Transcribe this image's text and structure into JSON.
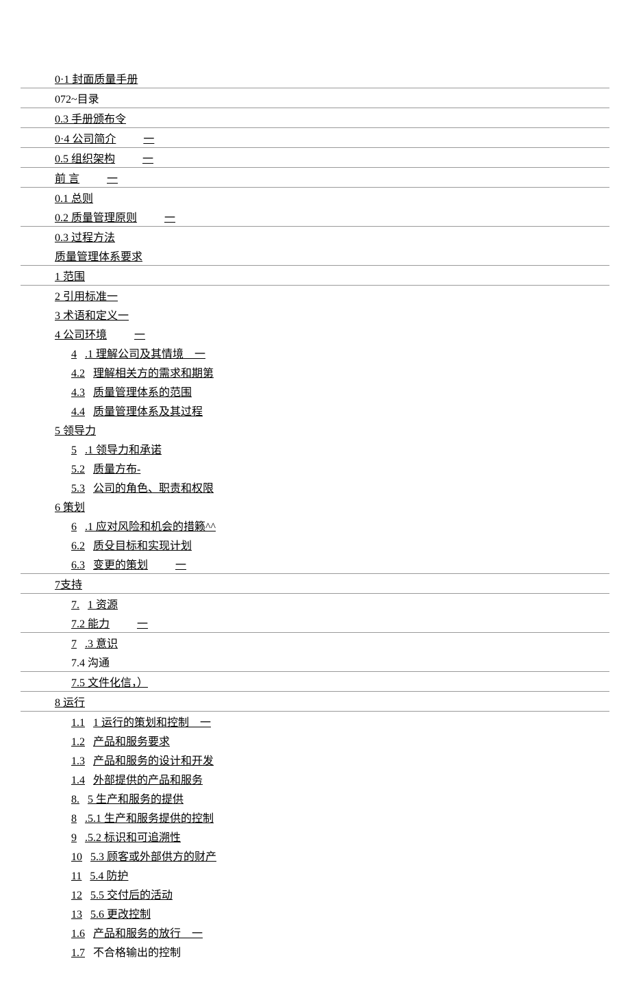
{
  "toc": {
    "rows": [
      {
        "indent": 0,
        "prefix": "",
        "text": "0·1 封面质量手册",
        "suffix": "",
        "underline": true,
        "border": true
      },
      {
        "indent": 0,
        "prefix": "",
        "text": "072~目录",
        "suffix": "",
        "underline": false,
        "border": true
      },
      {
        "indent": 0,
        "prefix": "",
        "text": "0.3 手册颁布令",
        "suffix": "",
        "underline": true,
        "border": true
      },
      {
        "indent": 0,
        "prefix": "",
        "text": "0·4 公司简介",
        "suffix": "一",
        "underline": true,
        "border": true
      },
      {
        "indent": 0,
        "prefix": "",
        "text": "0.5 组织架构",
        "suffix": "一",
        "underline": true,
        "border": true
      },
      {
        "indent": 0,
        "prefix": "",
        "text": "前 言",
        "suffix": "一",
        "underline": true,
        "border": true
      },
      {
        "indent": 0,
        "prefix": "",
        "text": "0.1 总则",
        "suffix": "",
        "underline": true,
        "border": false
      },
      {
        "indent": 0,
        "prefix": "",
        "text": "0.2 质量管理原则",
        "suffix": "一",
        "underline": true,
        "border": true
      },
      {
        "indent": 0,
        "prefix": "",
        "text": "0.3 过程方法",
        "suffix": "",
        "underline": true,
        "border": false
      },
      {
        "indent": 0,
        "prefix": "",
        "text": "质量管理体系要求",
        "suffix": "",
        "underline": true,
        "border": true
      },
      {
        "indent": 0,
        "prefix": "",
        "text": "1 范围",
        "suffix": "",
        "underline": true,
        "border": true
      },
      {
        "indent": 0,
        "prefix": "",
        "text": "2 引用标准一",
        "suffix": "",
        "underline": true,
        "border": false
      },
      {
        "indent": 0,
        "prefix": "",
        "text": "3 术语和定义一",
        "suffix": "",
        "underline": true,
        "border": false
      },
      {
        "indent": 0,
        "prefix": "",
        "text": "4 公司环境",
        "suffix": "一",
        "underline": true,
        "border": false
      },
      {
        "indent": 1,
        "prefix": "4",
        "text": ".1 理解公司及其情境    一",
        "suffix": "",
        "underline": true,
        "border": false
      },
      {
        "indent": 1,
        "prefix": "4.2",
        "text": "理解相关方的需求和期第",
        "suffix": "",
        "underline": true,
        "border": false
      },
      {
        "indent": 1,
        "prefix": "4.3",
        "text": "质量管理体系的范围",
        "suffix": "",
        "underline": true,
        "border": false
      },
      {
        "indent": 1,
        "prefix": "4.4",
        "text": "质量管理体系及其过程",
        "suffix": "",
        "underline": true,
        "border": false
      },
      {
        "indent": 0,
        "prefix": "",
        "text": "5 领导力",
        "suffix": "",
        "underline": true,
        "border": false
      },
      {
        "indent": 1,
        "prefix": "5",
        "text": ".1 领导力和承诺",
        "suffix": "",
        "underline": true,
        "border": false
      },
      {
        "indent": 1,
        "prefix": "5.2",
        "text": "质量方布-",
        "suffix": "",
        "underline": true,
        "border": false
      },
      {
        "indent": 1,
        "prefix": "5.3",
        "text": "公司的角色、职责和权限",
        "suffix": "",
        "underline": true,
        "border": false
      },
      {
        "indent": 0,
        "prefix": "",
        "text": "6 策划",
        "suffix": "",
        "underline": true,
        "border": false
      },
      {
        "indent": 1,
        "prefix": "6",
        "text": ".1 应对风险和机会的措籁^^",
        "suffix": "",
        "underline": true,
        "border": false
      },
      {
        "indent": 1,
        "prefix": "6.2",
        "text": "质殳目标和实现计划",
        "suffix": "",
        "underline": true,
        "border": false
      },
      {
        "indent": 1,
        "prefix": "6.3",
        "text": "变更的策划",
        "suffix": "一",
        "underline": true,
        "border": true
      },
      {
        "indent": 0,
        "prefix": "",
        "text": "7支持",
        "suffix": "",
        "underline": true,
        "border": true
      },
      {
        "indent": 1,
        "prefix": "7.",
        "text": "1 资源",
        "suffix": "",
        "underline": true,
        "border": false
      },
      {
        "indent": 1,
        "prefix": "",
        "text": "7.2 能力",
        "suffix": "一",
        "underline": true,
        "border": true
      },
      {
        "indent": 1,
        "prefix": "7",
        "text": ".3 意识",
        "suffix": "",
        "underline": true,
        "border": false
      },
      {
        "indent": 1,
        "prefix": "",
        "text": "7.4 沟通",
        "suffix": "",
        "underline": false,
        "border": true
      },
      {
        "indent": 1,
        "prefix": "",
        "text": "7.5 文件化信，）",
        "suffix": "",
        "underline": true,
        "border": true
      },
      {
        "indent": 0,
        "prefix": "",
        "text": "8 运行",
        "suffix": "",
        "underline": true,
        "border": true
      },
      {
        "indent": 1,
        "prefix": "1.1",
        "text": "1 运行的策划和控制    一",
        "suffix": "",
        "underline": true,
        "border": false
      },
      {
        "indent": 1,
        "prefix": "1.2",
        "text": "产品和服务要求",
        "suffix": "",
        "underline": true,
        "border": false
      },
      {
        "indent": 1,
        "prefix": "1.3",
        "text": "产品和服务的设计和开发",
        "suffix": "",
        "underline": true,
        "border": false
      },
      {
        "indent": 1,
        "prefix": "1.4",
        "text": "外部提供的产品和服务",
        "suffix": "",
        "underline": true,
        "border": false
      },
      {
        "indent": 1,
        "prefix": "8.",
        "text": "5 生产和服务的提供",
        "suffix": "",
        "underline": true,
        "border": false
      },
      {
        "indent": 1,
        "prefix": "8",
        "text": ".5.1 生产和服务提供的控制",
        "suffix": "",
        "underline": true,
        "border": false
      },
      {
        "indent": 1,
        "prefix": "9",
        "text": ".5.2 标识和可追溯性",
        "suffix": "",
        "underline": true,
        "border": false
      },
      {
        "indent": 1,
        "prefix": "10",
        "text": "5.3 顾客或外部供方的财产",
        "suffix": "",
        "underline": true,
        "border": false
      },
      {
        "indent": 1,
        "prefix": "11",
        "text": "5.4 防护",
        "suffix": "",
        "underline": true,
        "border": false
      },
      {
        "indent": 1,
        "prefix": "12",
        "text": "5.5 交付后的活动",
        "suffix": "",
        "underline": true,
        "border": false
      },
      {
        "indent": 1,
        "prefix": "13",
        "text": "5.6 更改控制",
        "suffix": "",
        "underline": true,
        "border": false
      },
      {
        "indent": 1,
        "prefix": "1.6",
        "text": "产品和服务的放行    一",
        "suffix": "",
        "underline": true,
        "border": false
      },
      {
        "indent": 1,
        "prefix": "1.7",
        "text": "不合格输出的控制",
        "suffix": "",
        "underline": false,
        "border": false
      }
    ]
  }
}
